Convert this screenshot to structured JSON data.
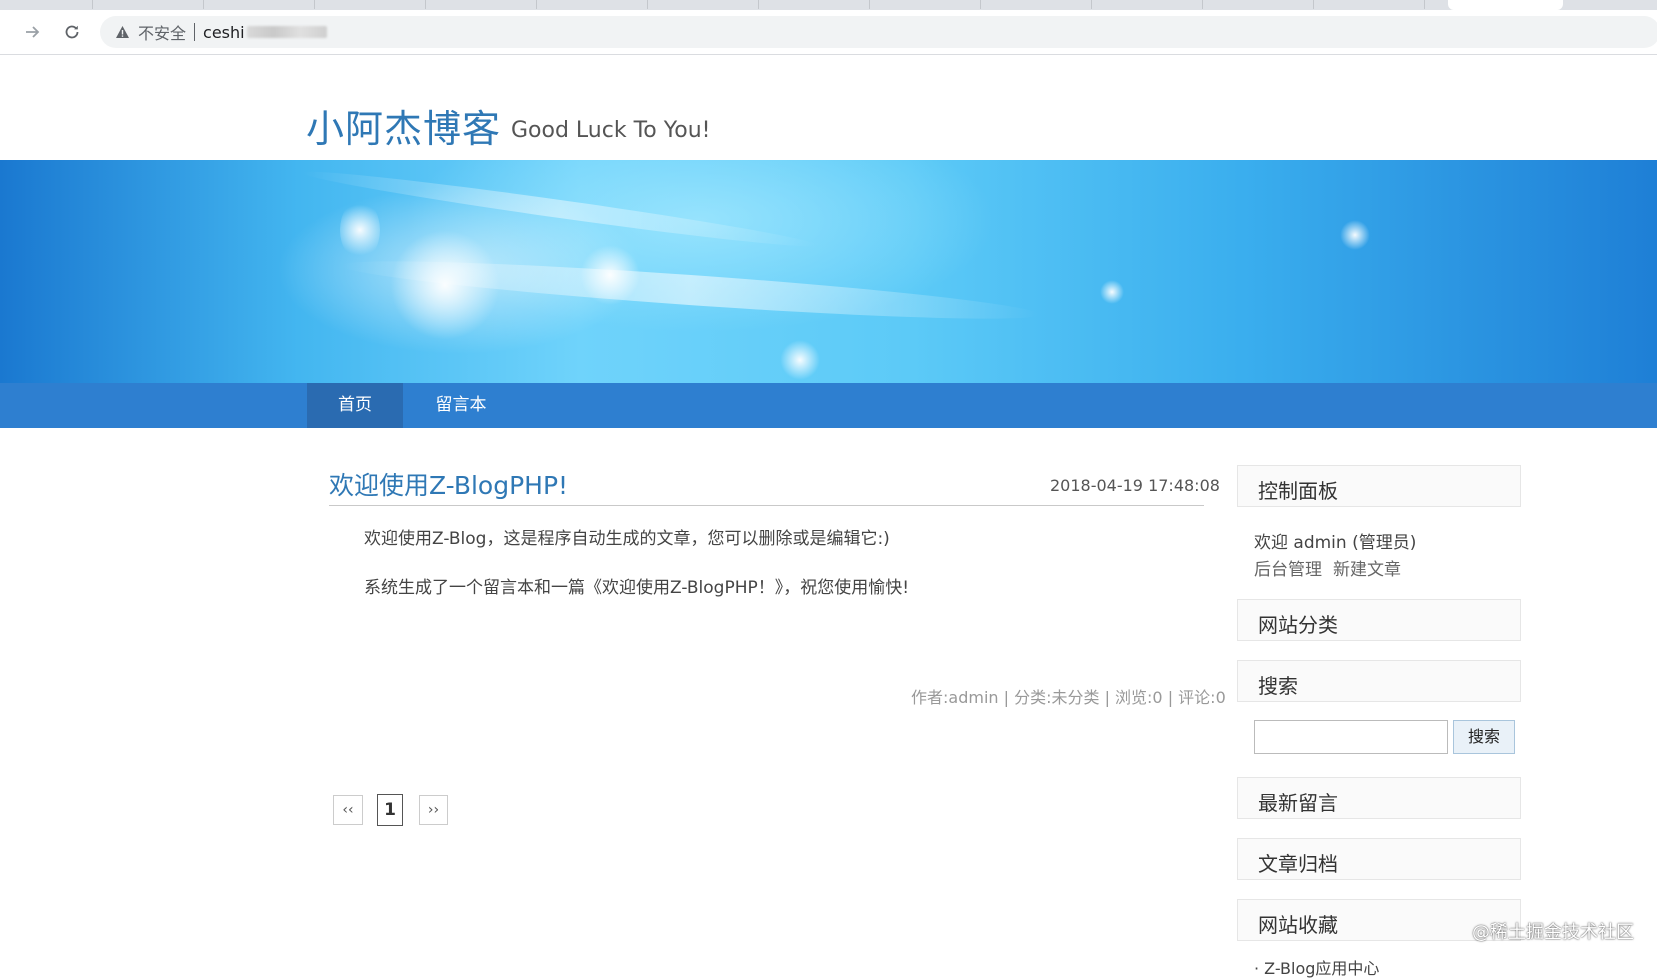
{
  "browser": {
    "insecure_label": "不安全",
    "url": "ceshi"
  },
  "site": {
    "title": "小阿杰博客",
    "subtitle": "Good Luck To You!"
  },
  "nav": {
    "items": [
      {
        "label": "首页",
        "active": true
      },
      {
        "label": "留言本",
        "active": false
      }
    ]
  },
  "post": {
    "title": "欢迎使用Z-BlogPHP!",
    "date": "2018-04-19 17:48:08",
    "paragraphs": [
      "欢迎使用Z-Blog，这是程序自动生成的文章，您可以删除或是编辑它:)",
      "系统生成了一个留言本和一篇《欢迎使用Z-BlogPHP！》，祝您使用愉快!"
    ],
    "meta": "作者:admin | 分类:未分类 | 浏览:0 | 评论:0"
  },
  "pagination": {
    "prev": "‹‹",
    "current": "1",
    "next": "››"
  },
  "sidebar": {
    "control_panel": {
      "title": "控制面板",
      "welcome": "欢迎 admin (管理员)",
      "links": [
        "后台管理",
        "新建文章"
      ]
    },
    "categories_title": "网站分类",
    "search": {
      "title": "搜索",
      "button": "搜索",
      "value": ""
    },
    "latest_comments_title": "最新留言",
    "archives_title": "文章归档",
    "favorites": {
      "title": "网站收藏",
      "first_item": "· Z-Blog应用中心"
    }
  },
  "watermark": "@稀土掘金技术社区"
}
